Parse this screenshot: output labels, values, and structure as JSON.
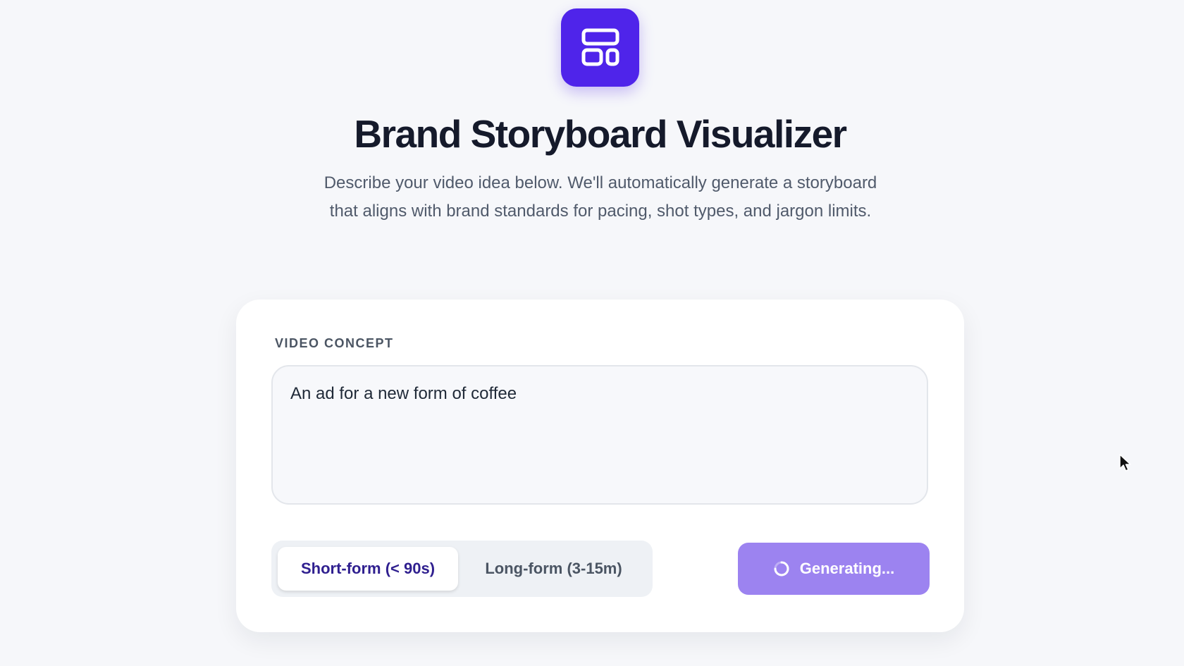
{
  "header": {
    "logo_icon": "layout-grid-icon",
    "title": "Brand Storyboard Visualizer",
    "subtitle": "Describe your video idea below. We'll automatically generate a storyboard that aligns with brand standards for pacing, shot types, and jargon limits."
  },
  "form": {
    "concept_label": "VIDEO CONCEPT",
    "concept_value": "An ad for a new form of coffee",
    "format_options": [
      {
        "label": "Short-form (< 90s)",
        "selected": true
      },
      {
        "label": "Long-form (3-15m)",
        "selected": false
      }
    ],
    "generate_button": {
      "label": "Generating...",
      "icon": "loading-spinner-icon",
      "state": "loading"
    }
  },
  "colors": {
    "accent": "#4f24ea",
    "button_loading": "#9c83f0",
    "background": "#f6f7fa",
    "card": "#ffffff"
  }
}
